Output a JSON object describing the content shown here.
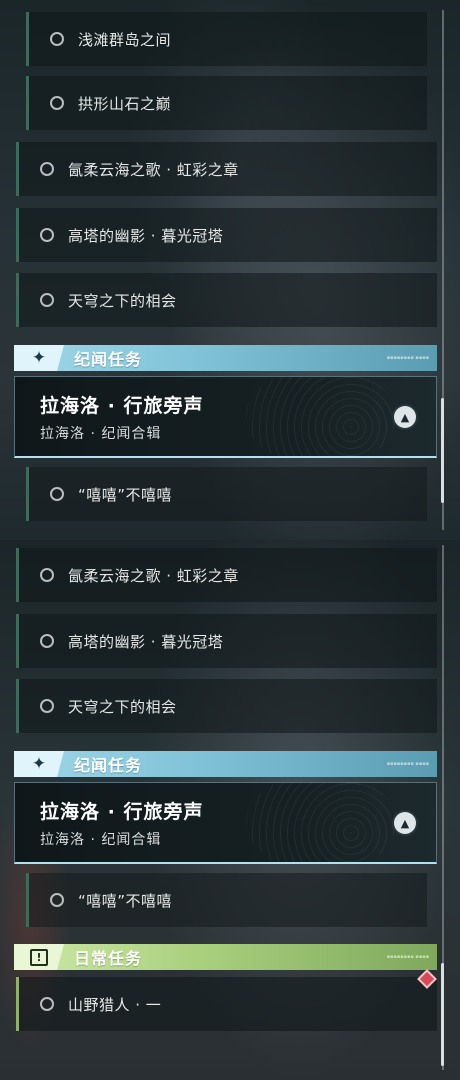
{
  "section1": {
    "rows_top": [
      {
        "label": "浅滩群岛之间"
      },
      {
        "label": "拱形山石之巅"
      },
      {
        "label": "氤柔云海之歌 · 虹彩之章"
      },
      {
        "label": "高塔的幽影 · 暮光冠塔"
      },
      {
        "label": "天穹之下的相会"
      }
    ],
    "category": {
      "title": "纪闻任务",
      "icon": "sparkle-icon",
      "color": "#7fc2d8"
    },
    "card": {
      "title": "拉海洛 · 行旅旁声",
      "subtitle": "拉海洛 · 纪闻合辑",
      "icon": "navigate-icon"
    },
    "sub_row": {
      "label": "“嘻嘻”不嘻嘻"
    }
  },
  "section2": {
    "rows_top": [
      {
        "label": "氤柔云海之歌 · 虹彩之章"
      },
      {
        "label": "高塔的幽影 · 暮光冠塔"
      },
      {
        "label": "天穹之下的相会"
      }
    ],
    "category": {
      "title": "纪闻任务",
      "icon": "sparkle-icon",
      "color": "#7fc2d8"
    },
    "card": {
      "title": "拉海洛 · 行旅旁声",
      "subtitle": "拉海洛 · 纪闻合辑",
      "icon": "navigate-icon"
    },
    "sub_row": {
      "label": "“嘻嘻”不嘻嘻"
    },
    "daily_category": {
      "title": "日常任务",
      "icon": "exclamation-icon",
      "color": "#a8cf7c"
    },
    "daily_row": {
      "label": "山野猎人 · 一"
    }
  },
  "colors": {
    "accent_blue": "#9fd7e8",
    "accent_green": "#a8cf7c",
    "pin": "#d64a58"
  }
}
